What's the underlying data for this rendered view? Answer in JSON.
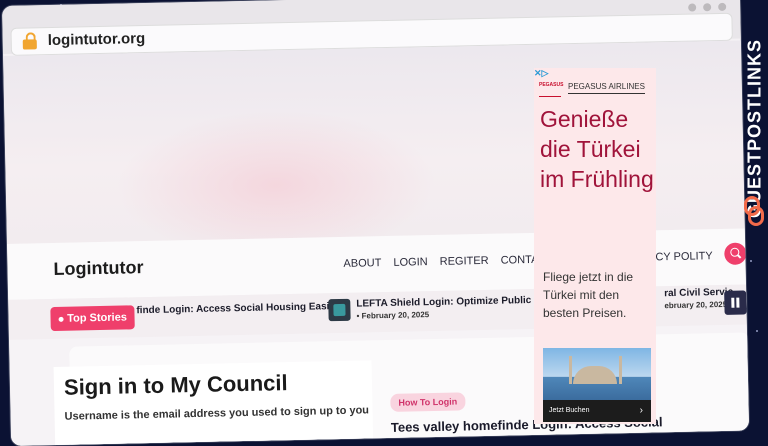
{
  "browser": {
    "url": "logintutor.org"
  },
  "site": {
    "logo": "Logintutor",
    "menu": [
      "ABOUT",
      "LOGIN",
      "REGITER",
      "CONTACT US"
    ],
    "menu_policy": "CY POLITY",
    "ticker": {
      "label": "Top Stories",
      "stories": [
        {
          "title": "finde Login: Access Social Housing Easily"
        },
        {
          "title": "LEFTA Shield Login: Optimize Public Safety",
          "date": "February 20, 2025"
        },
        {
          "title": "ral Civil Servic",
          "date": "ebruary 20, 2025"
        }
      ]
    },
    "login": {
      "title": "Sign in to My Council",
      "subtitle": "Username is the email address you used to sign up to you"
    },
    "article": {
      "tag": "How To Login",
      "title": "Tees valley homefinde Login: Access Social"
    }
  },
  "ad": {
    "choices_label": "▷",
    "brand": "PEGASUS AIRLINES",
    "logo_text": "PEGASUS",
    "headline": "Genieße die Türkei im Frühling",
    "body": "Fliege jetzt in die Türkei mit den besten Preisen.",
    "cta": "Jetzt Buchen"
  },
  "side_brand": "GUESTPOSTLINKS",
  "colors": {
    "accent": "#ef3f6b",
    "ad_headline": "#a0133a",
    "ad_bg": "#fde8ea"
  }
}
